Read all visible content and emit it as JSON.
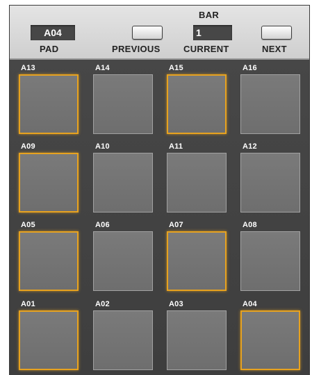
{
  "header": {
    "pad_display": "A04",
    "pad_label": "PAD",
    "previous_label": "PREVIOUS",
    "bar_label": "BAR",
    "bar_value": "1",
    "current_label": "CURRENT",
    "next_label": "NEXT"
  },
  "colors": {
    "lit_border": "#e7a21f",
    "pad_fill": "#757575",
    "background": "#444444"
  },
  "pads": [
    {
      "name": "A13",
      "lit": true
    },
    {
      "name": "A14",
      "lit": false
    },
    {
      "name": "A15",
      "lit": true
    },
    {
      "name": "A16",
      "lit": false
    },
    {
      "name": "A09",
      "lit": true
    },
    {
      "name": "A10",
      "lit": false
    },
    {
      "name": "A11",
      "lit": false
    },
    {
      "name": "A12",
      "lit": false
    },
    {
      "name": "A05",
      "lit": true
    },
    {
      "name": "A06",
      "lit": false
    },
    {
      "name": "A07",
      "lit": true
    },
    {
      "name": "A08",
      "lit": false
    },
    {
      "name": "A01",
      "lit": true
    },
    {
      "name": "A02",
      "lit": false
    },
    {
      "name": "A03",
      "lit": false
    },
    {
      "name": "A04",
      "lit": true
    }
  ]
}
